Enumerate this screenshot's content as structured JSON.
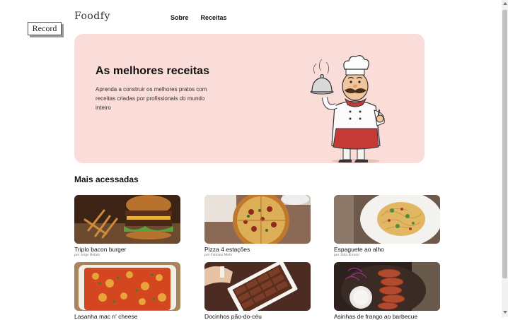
{
  "record": {
    "label": "Record"
  },
  "header": {
    "logo": "Foodfy",
    "nav": [
      "Sobre",
      "Receitas"
    ]
  },
  "hero": {
    "title": "As melhores receitas",
    "description": "Aprenda a construir os melhores pratos com receitas criadas por profissionais do mundo inteiro"
  },
  "section": {
    "title": "Mais acessadas"
  },
  "recipes": [
    {
      "name": "Triplo bacon burger",
      "author": "por Jorge Relato"
    },
    {
      "name": "Pizza 4 estações",
      "author": "por Fabiana Melo"
    },
    {
      "name": "Espaguete ao alho",
      "author": "por Júlia Kinoto"
    },
    {
      "name": "Lasanha mac n' cheese",
      "author": ""
    },
    {
      "name": "Docinhos pão-do-céu",
      "author": ""
    },
    {
      "name": "Asinhas de frango ao barbecue",
      "author": ""
    }
  ]
}
